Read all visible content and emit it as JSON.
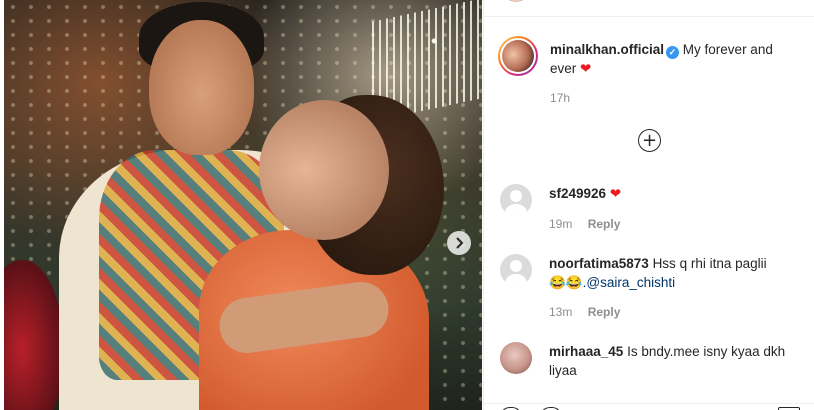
{
  "post": {
    "author": "minalkhan.official",
    "caption": "My forever and ever",
    "caption_emoji": "❤",
    "time": "17h"
  },
  "load_more_label": "+",
  "comments": [
    {
      "username": "sf249926",
      "text": "",
      "emoji": "❤",
      "time": "19m",
      "reply_label": "Reply"
    },
    {
      "username": "noorfatima5873",
      "text": "Hss q rhi itna paglii",
      "emoji": "😂😂",
      "mention": ".@saira_chishti",
      "time": "13m",
      "reply_label": "Reply"
    },
    {
      "username": "mirhaaa_45",
      "text": "Is bndy.mee isny kyaa dkh liyaa"
    }
  ],
  "icons": {
    "verified": "verified-badge-icon",
    "next": "chevron-right-icon",
    "add": "plus-circle-icon"
  },
  "colors": {
    "link": "#00376b",
    "muted": "#8e8e8e",
    "verified": "#3897f0",
    "heart": "#ed1c24"
  }
}
